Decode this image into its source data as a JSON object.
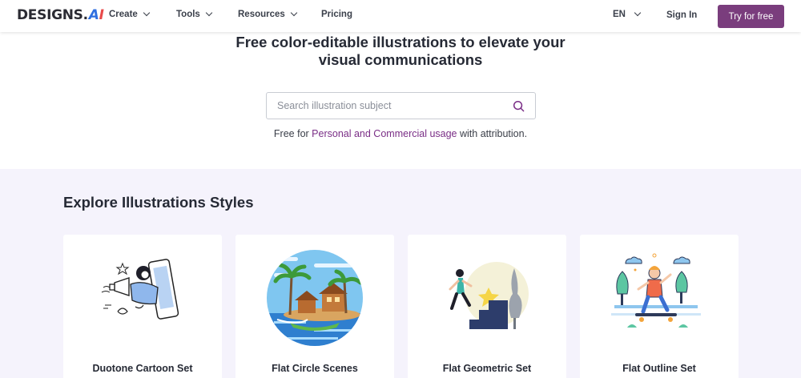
{
  "brand": {
    "logo_text": "DESIGNS.",
    "logo_ai": "AI"
  },
  "nav": {
    "items": [
      {
        "label": "Create",
        "dropdown": true
      },
      {
        "label": "Tools",
        "dropdown": true
      },
      {
        "label": "Resources",
        "dropdown": true
      },
      {
        "label": "Pricing",
        "dropdown": false
      }
    ],
    "language": "EN",
    "sign_in": "Sign In",
    "cta": "Try for free",
    "cta_color": "#7a3d7d"
  },
  "hero": {
    "title_line1": "Free color-editable illustrations to elevate your",
    "title_line2": "visual communications",
    "search_placeholder": "Search illustration subject",
    "search_value": "",
    "usage_prefix": "Free for ",
    "usage_link": "Personal and Commercial usage",
    "usage_suffix": " with attribution.",
    "link_color": "#7a2e86"
  },
  "explore": {
    "title": "Explore Illustrations Styles",
    "background": "#f5f3fc",
    "cards": [
      {
        "label": "Duotone Cartoon Set",
        "icon": "duotone-cartoon-illustration"
      },
      {
        "label": "Flat Circle Scenes",
        "icon": "flat-circle-scene-illustration"
      },
      {
        "label": "Flat Geometric Set",
        "icon": "flat-geometric-illustration"
      },
      {
        "label": "Flat Outline Set",
        "icon": "flat-outline-illustration"
      }
    ]
  }
}
